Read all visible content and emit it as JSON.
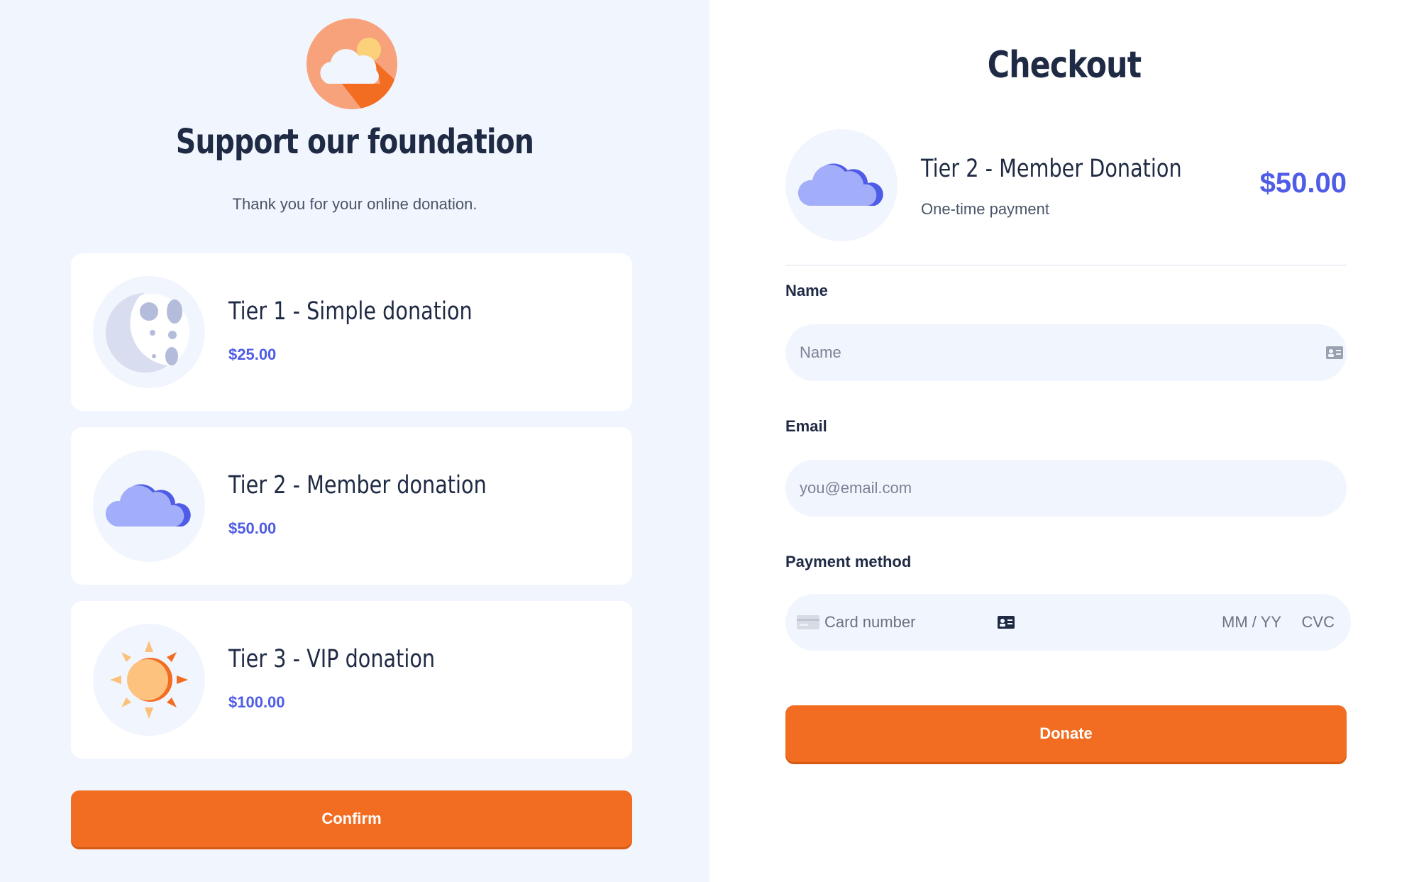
{
  "left": {
    "title": "Support our foundation",
    "subtitle": "Thank you for your online donation.",
    "logo_icon": "cloud-sun-icon",
    "tiers": [
      {
        "name": "Tier 1 - Simple donation",
        "price": "$25.00",
        "icon": "moon-icon"
      },
      {
        "name": "Tier 2 - Member donation",
        "price": "$50.00",
        "icon": "cloud-icon"
      },
      {
        "name": "Tier 3 - VIP donation",
        "price": "$100.00",
        "icon": "sun-icon"
      }
    ],
    "confirm_label": "Confirm"
  },
  "checkout": {
    "title": "Checkout",
    "item_name": "Tier 2 - Member Donation",
    "item_subtitle": "One-time payment",
    "item_price": "$50.00",
    "item_icon": "cloud-icon",
    "name_label": "Name",
    "name_placeholder": "Name",
    "email_label": "Email",
    "email_placeholder": "you@email.com",
    "payment_label": "Payment method",
    "card_placeholder": "Card number",
    "expiry_placeholder": "MM / YY",
    "cvc_placeholder": "CVC",
    "donate_label": "Donate"
  },
  "colors": {
    "accent": "#f26d21",
    "price": "#4f5ce6",
    "panel_bg": "#f1f5fd",
    "heading": "#1f2a44"
  }
}
